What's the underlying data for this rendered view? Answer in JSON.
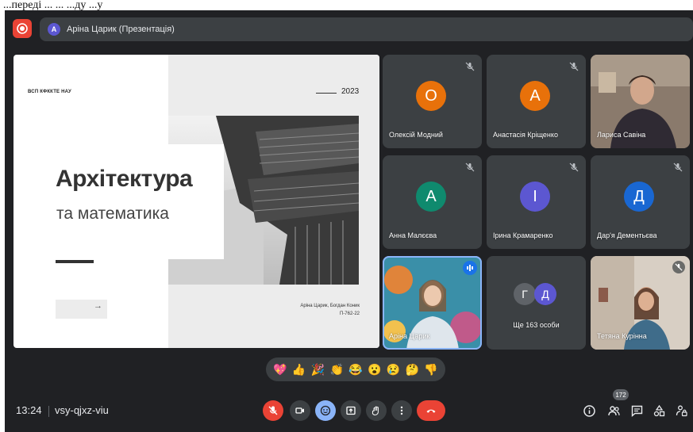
{
  "caption": "...переді ... ... ...ду ...у",
  "topbar": {
    "presenter_initial": "A",
    "presenter_label": "Аріна Царик (Презентація)"
  },
  "slide": {
    "org": "ВСП КФККТЕ НАУ",
    "year": "2023",
    "title": "Архітектура",
    "subtitle": "та математика",
    "button_arrow": "→",
    "authors": "Аріна Царик, Богдан Коник",
    "group": "П-762-22"
  },
  "participants": [
    {
      "name": "Олексій Модний",
      "initial": "О",
      "color": "#e8710a",
      "muted": true
    },
    {
      "name": "Анастасія Кріщенко",
      "initial": "А",
      "color": "#e8710a",
      "muted": true
    },
    {
      "name": "Лариса Савіна",
      "video": true
    },
    {
      "name": "Анна Малєєва",
      "initial": "А",
      "color": "#0f8a6e",
      "muted": true
    },
    {
      "name": "Ірина Крамаренко",
      "initial": "І",
      "color": "#5c57d1",
      "muted": true
    },
    {
      "name": "Дар'я Дементьєва",
      "initial": "Д",
      "color": "#1967d2",
      "muted": true
    },
    {
      "name": "Аріна Царик",
      "video": true,
      "speaking": true
    },
    {
      "name": "Ще 163 особи",
      "more": true,
      "initials": [
        "Г",
        "Д"
      ],
      "colors": [
        "#5f6368",
        "#5c57d1"
      ]
    },
    {
      "name": "Тетяна Курінна",
      "video": true,
      "muted": true
    }
  ],
  "reactions": [
    "💖",
    "👍",
    "🎉",
    "👏",
    "😂",
    "😮",
    "😢",
    "🤔",
    "👎"
  ],
  "bottombar": {
    "time": "13:24",
    "meeting_code": "vsy-qjxz-viu",
    "people_count": "172"
  },
  "colors": {
    "background": "#202124",
    "tile": "#3c4043",
    "danger": "#ea4335",
    "accent": "#8ab4f8"
  }
}
